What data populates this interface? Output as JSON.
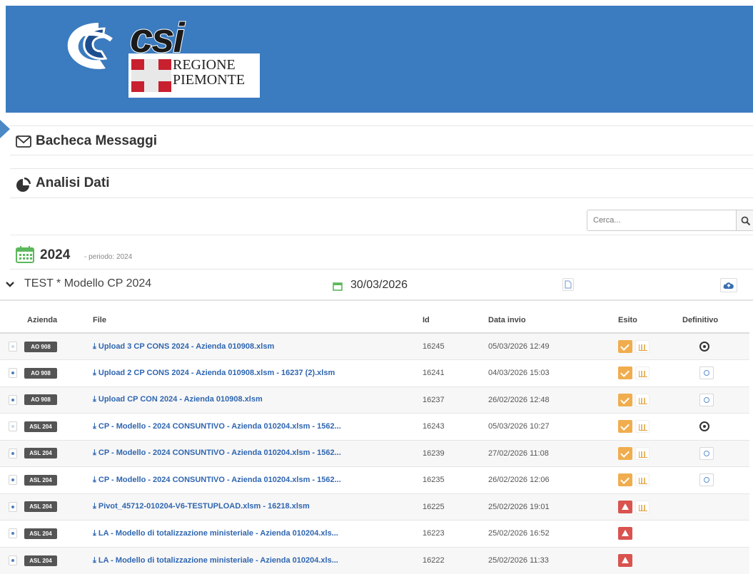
{
  "brand": {
    "logo_text": "csi",
    "region_line1": "REGIONE",
    "region_line2": "PIEMONTE"
  },
  "panels": {
    "messages_title": "Bacheca Messaggi",
    "analysis_title": "Analisi Dati"
  },
  "search": {
    "placeholder": "Cerca..."
  },
  "period": {
    "year": "2024",
    "label": "- periodo: 2024"
  },
  "model": {
    "title": "TEST * Modello CP 2024",
    "date": "30/03/2026"
  },
  "colors": {
    "header_bg": "#3b7bbf",
    "link": "#2f66b0",
    "esito_ok": "#f0ad4e",
    "esito_ko": "#d9534f",
    "calendar_green": "#5cb85c"
  },
  "table": {
    "headers": {
      "azienda": "Azienda",
      "file": "File",
      "id": "Id",
      "data_invio": "Data invio",
      "esito": "Esito",
      "definitivo": "Definitivo"
    },
    "rows": [
      {
        "azienda": "AO 908",
        "file": "Upload 3 CP CONS 2024 - Azienda 010908.xlsm",
        "id": "16245",
        "data_invio": "05/03/2026 12:49",
        "esito": "ok",
        "chart": true,
        "definitivo": "dark"
      },
      {
        "azienda": "AO 908",
        "file": "Upload 2 CP CONS 2024 - Azienda 010908.xlsm - 16237 (2).xlsm",
        "id": "16241",
        "data_invio": "04/03/2026 15:03",
        "esito": "ok",
        "chart": true,
        "definitivo": "light"
      },
      {
        "azienda": "AO 908",
        "file": "Upload CP CON 2024 - Azienda 010908.xlsm",
        "id": "16237",
        "data_invio": "26/02/2026 12:48",
        "esito": "ok",
        "chart": true,
        "definitivo": "light"
      },
      {
        "azienda": "ASL 204",
        "file": "CP - Modello - 2024 CONSUNTIVO - Azienda 010204.xlsm - 1562...",
        "id": "16243",
        "data_invio": "05/03/2026 10:27",
        "esito": "ok",
        "chart": true,
        "definitivo": "dark"
      },
      {
        "azienda": "ASL 204",
        "file": "CP - Modello - 2024 CONSUNTIVO - Azienda 010204.xlsm - 1562...",
        "id": "16239",
        "data_invio": "27/02/2026 11:08",
        "esito": "ok",
        "chart": true,
        "definitivo": "light"
      },
      {
        "azienda": "ASL 204",
        "file": "CP - Modello - 2024 CONSUNTIVO - Azienda 010204.xlsm - 1562...",
        "id": "16235",
        "data_invio": "26/02/2026 12:06",
        "esito": "ok",
        "chart": true,
        "definitivo": "light"
      },
      {
        "azienda": "ASL 204",
        "file": "Pivot_45712-010204-V6-TESTUPLOAD.xlsm - 16218.xlsm",
        "id": "16225",
        "data_invio": "25/02/2026 19:01",
        "esito": "ko",
        "chart": true,
        "definitivo": ""
      },
      {
        "azienda": "ASL 204",
        "file": "LA - Modello di totalizzazione ministeriale - Azienda 010204.xls...",
        "id": "16223",
        "data_invio": "25/02/2026 16:52",
        "esito": "ko",
        "chart": false,
        "definitivo": ""
      },
      {
        "azienda": "ASL 204",
        "file": "LA - Modello di totalizzazione ministeriale - Azienda 010204.xls...",
        "id": "16222",
        "data_invio": "25/02/2026 11:33",
        "esito": "ko",
        "chart": false,
        "definitivo": ""
      }
    ]
  }
}
